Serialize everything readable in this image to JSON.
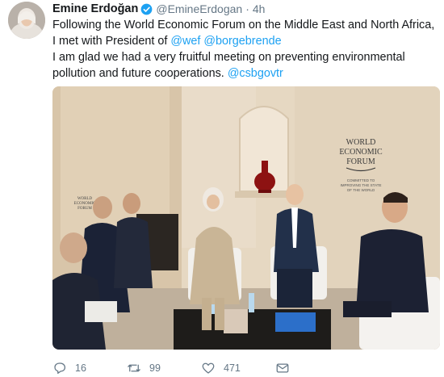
{
  "author": {
    "display_name": "Emine Erdoğan",
    "handle": "@EmineErdogan",
    "separator": "·",
    "time": "4h",
    "verified": true
  },
  "tweet": {
    "text_1": "Following the World Economic Forum on the Middle East and North Africa, I met with President of ",
    "mention_1": "@wef",
    "space_1": " ",
    "mention_2": "@borgebrende",
    "text_2": "I am glad we had a very fruitful meeting on preventing environmental pollution and future cooperations. ",
    "mention_3": "@csbgovtr"
  },
  "media": {
    "sign_right": [
      "WORLD",
      "ECONOMIC",
      "FORUM"
    ],
    "sign_right_tagline": [
      "COMMITTED TO",
      "IMPROVING THE STATE",
      "OF THE WORLD"
    ],
    "sign_left": [
      "WORLD",
      "ECONOMIC",
      "FORUM"
    ]
  },
  "actions": {
    "reply_count": "16",
    "retweet_count": "99",
    "like_count": "471",
    "icons": [
      "reply-icon",
      "retweet-icon",
      "like-icon",
      "dm-icon"
    ]
  },
  "colors": {
    "link": "#1da1f2",
    "secondary_text": "#657786",
    "verified_badge": "#1da1f2"
  }
}
